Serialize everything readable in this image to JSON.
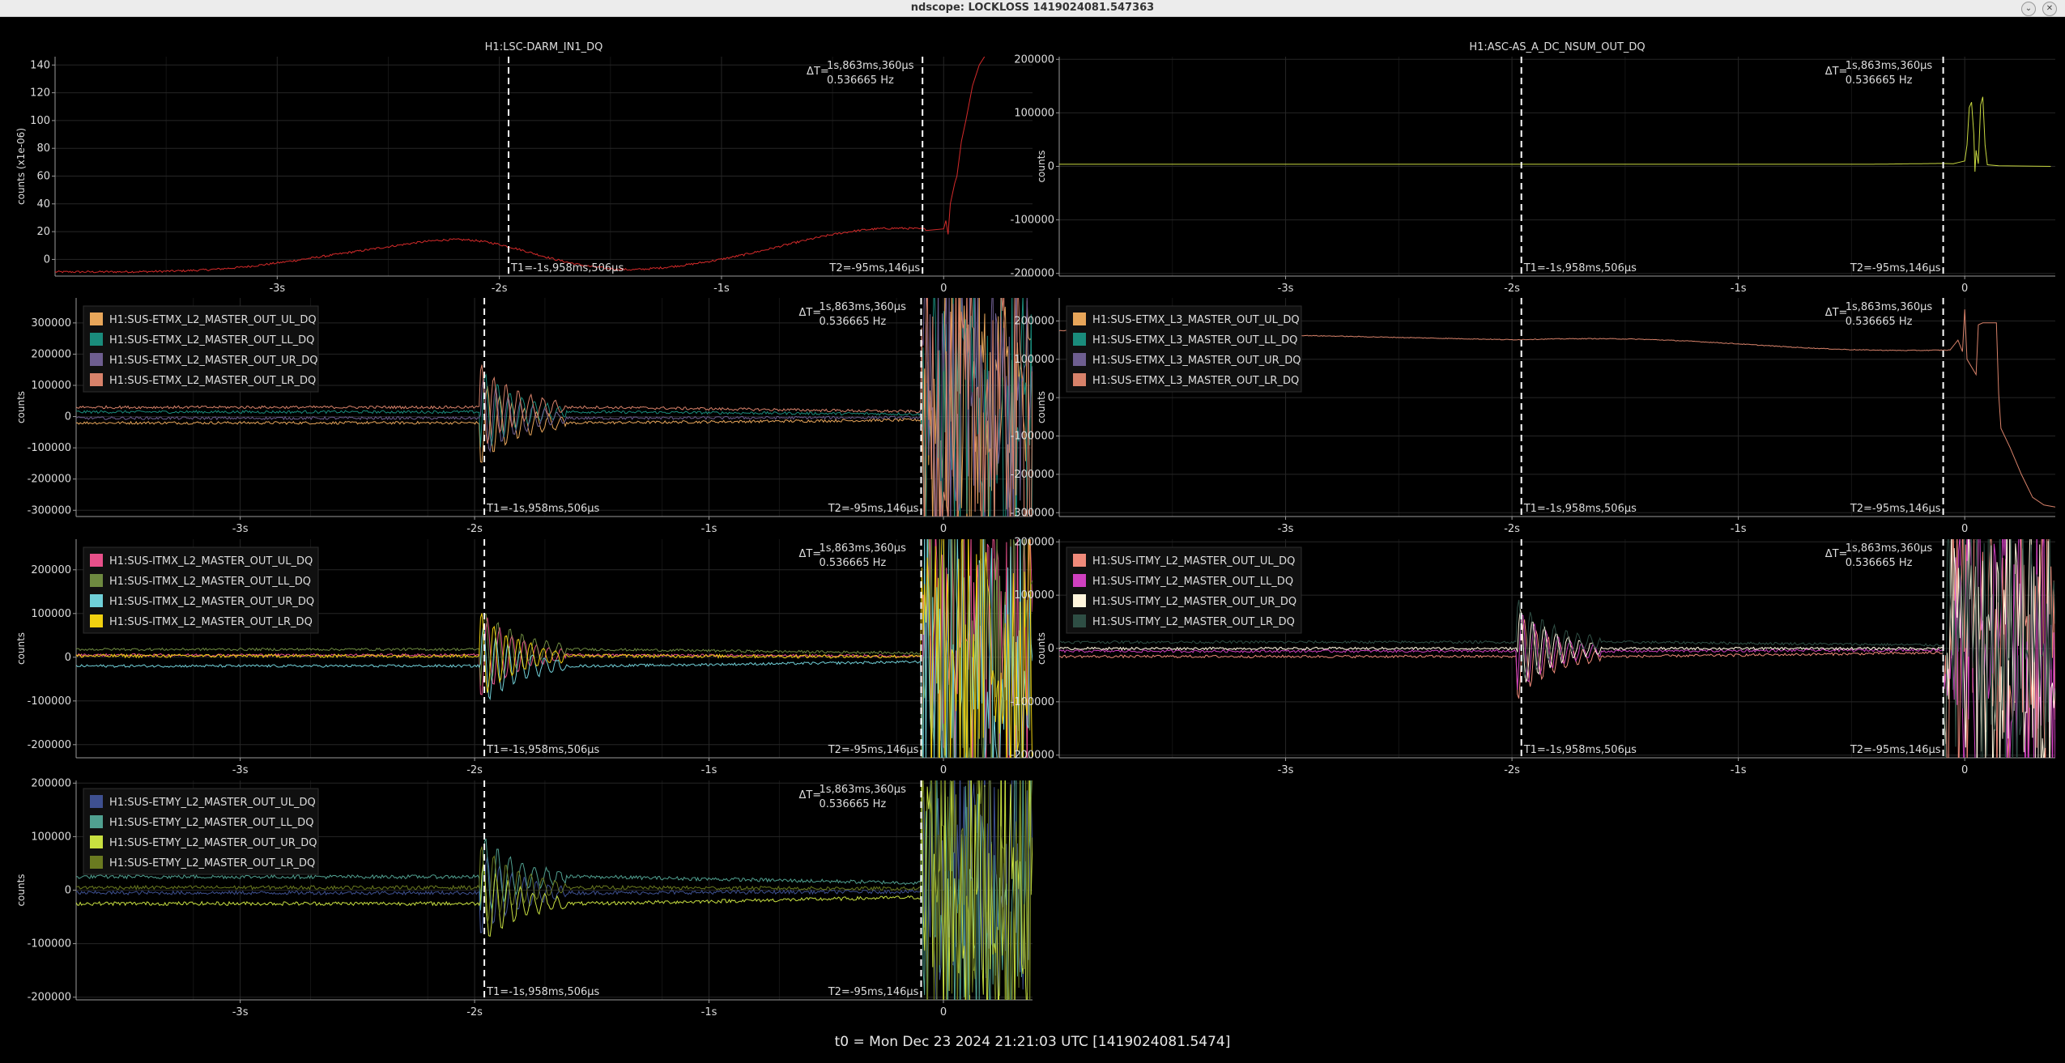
{
  "window": {
    "title": "ndscope: LOCKLOSS 1419024081.547363"
  },
  "footer": {
    "t0": "t0 = Mon Dec 23 2024 21:21:03 UTC [1419024081.5474]"
  },
  "cursors": {
    "t1_label": "T1=-1s,958ms,506µs",
    "t2_label": "T2=-95ms,146µs",
    "delta_prefix": "ΔT=",
    "delta_time": "1s,863ms,360µs",
    "delta_freq": "0.536665 Hz",
    "t1": -1.958506,
    "t2": -0.095146
  },
  "colors": {
    "bg": "#000000",
    "grid": "#262626",
    "axis": "#9a9a9a",
    "text": "#dddddd",
    "cursor": "#ffffff"
  },
  "chart_data": [
    {
      "id": "p1",
      "title": "H1:LSC-DARM_IN1_DQ",
      "ylabel": "counts (x1e-06)",
      "yticks": [
        "140",
        "120",
        "100",
        "80",
        "60",
        "40",
        "20",
        "0"
      ],
      "yvals": [
        140,
        120,
        100,
        80,
        60,
        40,
        20,
        0
      ],
      "ylim": [
        -12,
        146
      ],
      "xticks": [
        "-3s",
        "-2s",
        "-1s",
        "0"
      ],
      "xvals": [
        -3,
        -2,
        -1,
        0
      ],
      "xlim": [
        -4.0,
        0.4
      ],
      "legend": [],
      "type": "line",
      "series": [
        {
          "name": "",
          "color": "#d42a2a",
          "kind": "darm"
        }
      ]
    },
    {
      "id": "p2",
      "title": "H1:ASC-AS_A_DC_NSUM_OUT_DQ",
      "ylabel": "counts",
      "yticks": [
        "200000",
        "100000",
        "0",
        "-100000",
        "-200000"
      ],
      "yvals": [
        200000,
        100000,
        0,
        -100000,
        -200000
      ],
      "ylim": [
        -205000,
        205000
      ],
      "xticks": [
        "-3s",
        "-2s",
        "-1s",
        "0"
      ],
      "xvals": [
        -3,
        -2,
        -1,
        0
      ],
      "xlim": [
        -4.0,
        0.4
      ],
      "legend": [],
      "type": "line",
      "series": [
        {
          "name": "",
          "color": "#c8d840",
          "kind": "nsum"
        }
      ]
    },
    {
      "id": "p3",
      "title": "",
      "ylabel": "counts",
      "yticks": [
        "300000",
        "200000",
        "100000",
        "0",
        "-100000",
        "-200000",
        "-300000"
      ],
      "yvals": [
        300000,
        200000,
        100000,
        0,
        -100000,
        -200000,
        -300000
      ],
      "ylim": [
        -320000,
        380000
      ],
      "xticks": [
        "-3s",
        "-2s",
        "-1s",
        "0"
      ],
      "xvals": [
        -3,
        -2,
        -1,
        0
      ],
      "xlim": [
        -3.7,
        0.38
      ],
      "type": "line",
      "legend": [
        {
          "label": "H1:SUS-ETMX_L2_MASTER_OUT_UL_DQ",
          "color": "#e8a65a"
        },
        {
          "label": "H1:SUS-ETMX_L2_MASTER_OUT_LL_DQ",
          "color": "#1a8c7c"
        },
        {
          "label": "H1:SUS-ETMX_L2_MASTER_OUT_UR_DQ",
          "color": "#6e5e90"
        },
        {
          "label": "H1:SUS-ETMX_L2_MASTER_OUT_LR_DQ",
          "color": "#d8826a"
        }
      ],
      "series": [
        {
          "name": "H1:SUS-ETMX_L2_MASTER_OUT_UL_DQ",
          "color": "#e8a65a",
          "kind": "noise",
          "offset": -20000,
          "amp": 9000
        },
        {
          "name": "H1:SUS-ETMX_L2_MASTER_OUT_LL_DQ",
          "color": "#1a8c7c",
          "kind": "noise",
          "offset": 15000,
          "amp": 9000
        },
        {
          "name": "H1:SUS-ETMX_L2_MASTER_OUT_UR_DQ",
          "color": "#6e5e90",
          "kind": "noise",
          "offset": -5000,
          "amp": 9000
        },
        {
          "name": "H1:SUS-ETMX_L2_MASTER_OUT_LR_DQ",
          "color": "#d8826a",
          "kind": "noise",
          "offset": 30000,
          "amp": 9000
        }
      ]
    },
    {
      "id": "p4",
      "title": "",
      "ylabel": "counts",
      "yticks": [
        "200000",
        "100000",
        "0",
        "-100000",
        "-200000",
        "-300000"
      ],
      "yvals": [
        200000,
        100000,
        0,
        -100000,
        -200000,
        -300000
      ],
      "ylim": [
        -310000,
        260000
      ],
      "xticks": [
        "-3s",
        "-2s",
        "-1s",
        "0"
      ],
      "xvals": [
        -3,
        -2,
        -1,
        0
      ],
      "xlim": [
        -4.0,
        0.4
      ],
      "type": "line",
      "legend": [
        {
          "label": "H1:SUS-ETMX_L3_MASTER_OUT_UL_DQ",
          "color": "#e8a65a"
        },
        {
          "label": "H1:SUS-ETMX_L3_MASTER_OUT_LL_DQ",
          "color": "#1a8c7c"
        },
        {
          "label": "H1:SUS-ETMX_L3_MASTER_OUT_UR_DQ",
          "color": "#6e5e90"
        },
        {
          "label": "H1:SUS-ETMX_L3_MASTER_OUT_LR_DQ",
          "color": "#d8826a"
        }
      ],
      "series": [
        {
          "name": "H1:SUS-ETMX_L3_MASTER_OUT_LR_DQ",
          "color": "#d8826a",
          "kind": "l3"
        }
      ]
    },
    {
      "id": "p5",
      "title": "",
      "ylabel": "counts",
      "yticks": [
        "200000",
        "100000",
        "0",
        "-100000",
        "-200000"
      ],
      "yvals": [
        200000,
        100000,
        0,
        -100000,
        -200000
      ],
      "ylim": [
        -230000,
        270000
      ],
      "xticks": [
        "-3s",
        "-2s",
        "-1s",
        "0"
      ],
      "xvals": [
        -3,
        -2,
        -1,
        0
      ],
      "xlim": [
        -3.7,
        0.38
      ],
      "type": "line",
      "legend": [
        {
          "label": "H1:SUS-ITMX_L2_MASTER_OUT_UL_DQ",
          "color": "#e8508a"
        },
        {
          "label": "H1:SUS-ITMX_L2_MASTER_OUT_LL_DQ",
          "color": "#6e8a40"
        },
        {
          "label": "H1:SUS-ITMX_L2_MASTER_OUT_UR_DQ",
          "color": "#70d0d8"
        },
        {
          "label": "H1:SUS-ITMX_L2_MASTER_OUT_LR_DQ",
          "color": "#f0d010"
        }
      ],
      "series": [
        {
          "name": "H1:SUS-ITMX_L2_MASTER_OUT_UL_DQ",
          "color": "#e8508a",
          "kind": "noise",
          "offset": 5000,
          "amp": 6000
        },
        {
          "name": "H1:SUS-ITMX_L2_MASTER_OUT_LL_DQ",
          "color": "#6e8a40",
          "kind": "noise",
          "offset": 18000,
          "amp": 6000
        },
        {
          "name": "H1:SUS-ITMX_L2_MASTER_OUT_UR_DQ",
          "color": "#70d0d8",
          "kind": "noise",
          "offset": -20000,
          "amp": 6000
        },
        {
          "name": "H1:SUS-ITMX_L2_MASTER_OUT_LR_DQ",
          "color": "#f0d010",
          "kind": "noise",
          "offset": 3000,
          "amp": 8000
        }
      ]
    },
    {
      "id": "p6",
      "title": "",
      "ylabel": "counts",
      "yticks": [
        "200000",
        "100000",
        "0",
        "-100000",
        "-200000"
      ],
      "yvals": [
        200000,
        100000,
        0,
        -100000,
        -200000
      ],
      "ylim": [
        -205000,
        205000
      ],
      "xticks": [
        "-3s",
        "-2s",
        "-1s",
        "0"
      ],
      "xvals": [
        -3,
        -2,
        -1,
        0
      ],
      "xlim": [
        -4.0,
        0.4
      ],
      "type": "line",
      "legend": [
        {
          "label": "H1:SUS-ITMY_L2_MASTER_OUT_UL_DQ",
          "color": "#f08a7a"
        },
        {
          "label": "H1:SUS-ITMY_L2_MASTER_OUT_LL_DQ",
          "color": "#d040c0"
        },
        {
          "label": "H1:SUS-ITMY_L2_MASTER_OUT_UR_DQ",
          "color": "#fff5dc"
        },
        {
          "label": "H1:SUS-ITMY_L2_MASTER_OUT_LR_DQ",
          "color": "#2e4e44"
        }
      ],
      "series": [
        {
          "name": "H1:SUS-ITMY_L2_MASTER_OUT_UL_DQ",
          "color": "#f08a7a",
          "kind": "noise",
          "offset": -15000,
          "amp": 5000
        },
        {
          "name": "H1:SUS-ITMY_L2_MASTER_OUT_LL_DQ",
          "color": "#d040c0",
          "kind": "noise",
          "offset": -5000,
          "amp": 5000
        },
        {
          "name": "H1:SUS-ITMY_L2_MASTER_OUT_UR_DQ",
          "color": "#fff5dc",
          "kind": "noise",
          "offset": 0,
          "amp": 5000
        },
        {
          "name": "H1:SUS-ITMY_L2_MASTER_OUT_LR_DQ",
          "color": "#2e4e44",
          "kind": "noise",
          "offset": 12000,
          "amp": 5000
        }
      ]
    },
    {
      "id": "p7",
      "title": "",
      "ylabel": "counts",
      "yticks": [
        "200000",
        "100000",
        "0",
        "-100000",
        "-200000"
      ],
      "yvals": [
        200000,
        100000,
        0,
        -100000,
        -200000
      ],
      "ylim": [
        -205000,
        205000
      ],
      "xticks": [
        "-3s",
        "-2s",
        "-1s",
        "0"
      ],
      "xvals": [
        -3,
        -2,
        -1,
        0
      ],
      "xlim": [
        -3.7,
        0.38
      ],
      "type": "line",
      "legend": [
        {
          "label": "H1:SUS-ETMY_L2_MASTER_OUT_UL_DQ",
          "color": "#3e5090"
        },
        {
          "label": "H1:SUS-ETMY_L2_MASTER_OUT_LL_DQ",
          "color": "#50a090"
        },
        {
          "label": "H1:SUS-ETMY_L2_MASTER_OUT_UR_DQ",
          "color": "#c8e040"
        },
        {
          "label": "H1:SUS-ETMY_L2_MASTER_OUT_LR_DQ",
          "color": "#6a7a20"
        }
      ],
      "series": [
        {
          "name": "H1:SUS-ETMY_L2_MASTER_OUT_UL_DQ",
          "color": "#3e5090",
          "kind": "noise",
          "offset": -5000,
          "amp": 7000
        },
        {
          "name": "H1:SUS-ETMY_L2_MASTER_OUT_LL_DQ",
          "color": "#50a090",
          "kind": "noise",
          "offset": 25000,
          "amp": 7000
        },
        {
          "name": "H1:SUS-ETMY_L2_MASTER_OUT_UR_DQ",
          "color": "#c8e040",
          "kind": "noise",
          "offset": -25000,
          "amp": 7000
        },
        {
          "name": "H1:SUS-ETMY_L2_MASTER_OUT_LR_DQ",
          "color": "#6a7a20",
          "kind": "noise",
          "offset": 5000,
          "amp": 7000
        }
      ]
    }
  ]
}
